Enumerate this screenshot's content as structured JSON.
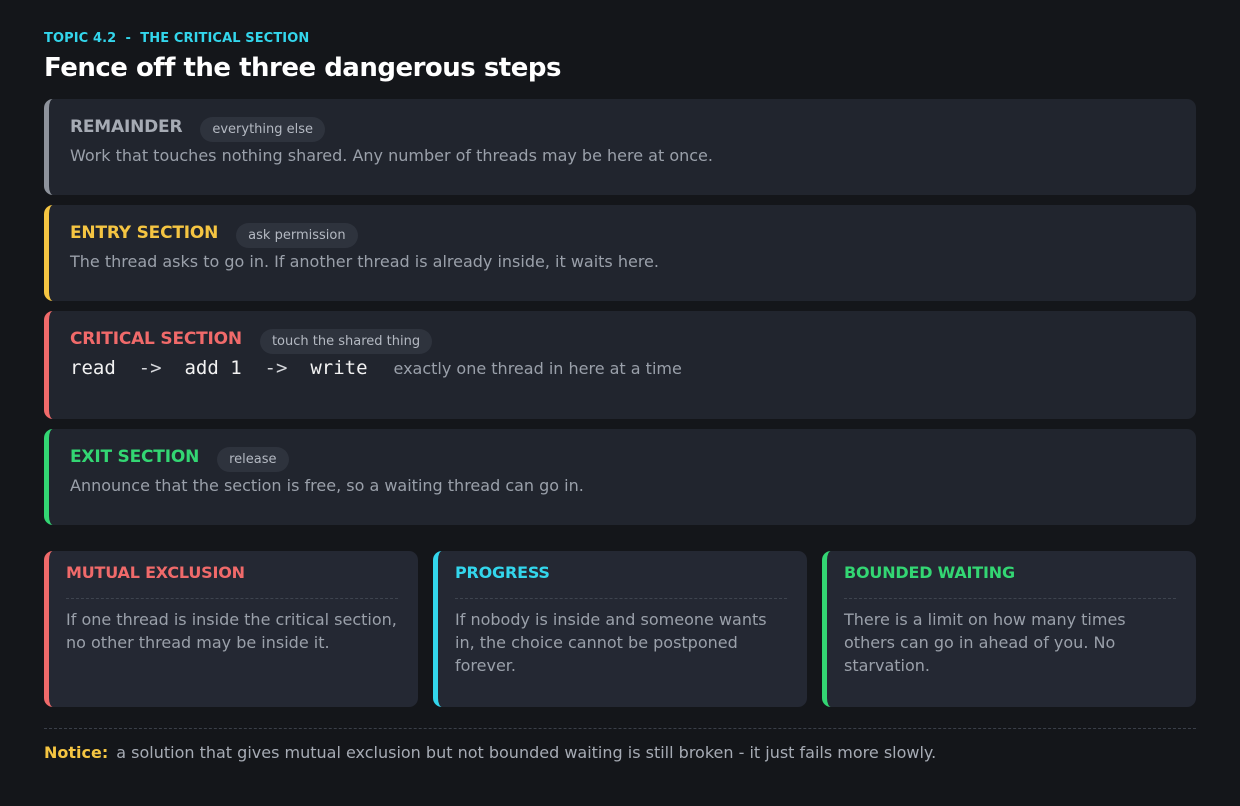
{
  "header": {
    "eyebrow": "TOPIC 4.2  -  THE CRITICAL SECTION",
    "title": "Fence off the three dangerous steps"
  },
  "sections": [
    {
      "name": "REMAINDER",
      "tag": "everything else",
      "description": "Work that touches nothing shared. Any number of threads may be here at once.",
      "color": "#8e939c"
    },
    {
      "name": "ENTRY SECTION",
      "tag": "ask permission",
      "description": "The thread asks to go in. If another thread is already inside, it waits here.",
      "color": "#f5c542"
    },
    {
      "name": "CRITICAL SECTION",
      "tag": "touch the shared thing",
      "steps": [
        "read",
        "add 1",
        "write"
      ],
      "arrow": "->",
      "note": "exactly one thread in here at a time",
      "color": "#f06a6a"
    },
    {
      "name": "EXIT SECTION",
      "tag": "release",
      "description": "Announce that the section is free, so a waiting thread can go in.",
      "color": "#33d673"
    }
  ],
  "rules": [
    {
      "name": "MUTUAL EXCLUSION",
      "text": "If one thread is inside the critical section, no other thread may be inside it.",
      "color": "#f06a6a"
    },
    {
      "name": "PROGRESS",
      "text": "If nobody is inside and someone wants in, the choice cannot be postponed forever.",
      "color": "#33d6ec"
    },
    {
      "name": "BOUNDED WAITING",
      "text": "There is a limit on how many times others can go in ahead of you. No starvation.",
      "color": "#33d673"
    }
  ],
  "footer": {
    "label": "Notice:",
    "text": "a solution that gives mutual exclusion but not bounded waiting is still broken - it just fails more slowly."
  }
}
